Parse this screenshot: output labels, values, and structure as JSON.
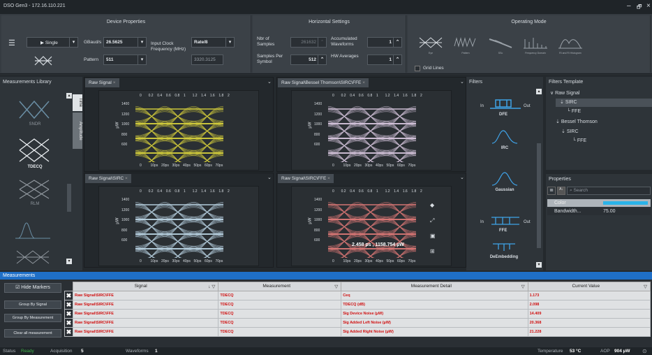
{
  "title": "DSO Gen3 - 172.16.110.221",
  "window_controls": [
    "–",
    "🗗",
    "×"
  ],
  "device_properties": {
    "title": "Device Properties",
    "mode": "Single",
    "gbaud_label": "GBaud/s",
    "gbaud_value": "26.5625",
    "input_clock_label": "Input Clock Frequency (MHz)",
    "rate_value": "Rate/8",
    "freq_value": "3320.3125",
    "pattern_label": "Pattern",
    "pattern_value": "511"
  },
  "horizontal": {
    "title": "Horizontal Settings",
    "nbr_samples_label": "Nbr of Samples",
    "nbr_samples_value": "261632",
    "accum_label": "Accumulated Waveforms",
    "accum_value": "1",
    "sps_label": "Samples Per Symbol",
    "sps_value": "512",
    "hw_avg_label": "HW Averages",
    "hw_avg_value": "1"
  },
  "operating": {
    "title": "Operating Mode",
    "modes": [
      "Eye",
      "Pattern",
      "SSc",
      "Frequency Domain",
      "RI and RI Histogram"
    ],
    "grid_lines": "Grid Lines"
  },
  "meas_library": {
    "title": "Measurements Library",
    "items": [
      "SNDR",
      "TDECQ",
      "RLM",
      "",
      "Time",
      "Amplitude"
    ]
  },
  "plots": [
    {
      "tab": "Raw Signal",
      "color": "#d8d23c"
    },
    {
      "tab": "Raw Signal\\Bessel Thomson\\SIRC\\FFE",
      "color": "#d9c8e0"
    },
    {
      "tab": "Raw Signal\\SIRC",
      "color": "#bcd6e6"
    },
    {
      "tab": "Raw Signal\\SIRC\\FFE",
      "color": "#e07a78"
    }
  ],
  "plot_axes": {
    "top_ticks": [
      "0",
      "0.2",
      "0.4",
      "0.6",
      "0.8",
      "1",
      "1.2",
      "1.4",
      "1.6",
      "1.8",
      "2"
    ],
    "bottom_ticks": [
      "0",
      "10ps",
      "20ps",
      "30ps",
      "40ps",
      "50ps",
      "60ps",
      "70ps"
    ],
    "y_ticks": [
      "1400",
      "1200",
      "1000",
      "800",
      "600"
    ],
    "y_label": "µW"
  },
  "cursor_readout": "2.458 ps , 1158.754 µW",
  "filters": {
    "title": "Filters",
    "items": [
      "DFE",
      "IRC",
      "Gaussian",
      "FFE",
      "DeEmbedding"
    ],
    "in": "In",
    "out": "Out"
  },
  "filters_template": {
    "title": "Filters Template",
    "tree": [
      "Raw Signal",
      "SIRC",
      "FFE",
      "Bessel Thomson",
      "SIRC",
      "FFE"
    ]
  },
  "properties": {
    "title": "Properties",
    "search_placeholder": "Search",
    "rows": [
      {
        "name": "Color",
        "value": ""
      },
      {
        "name": "Bandwidth...",
        "value": "75.00"
      }
    ]
  },
  "measurements": {
    "bar_title": "Measurements",
    "hide_markers": "Hide Markers",
    "buttons": [
      "Group By Signal",
      "Group By Measurement",
      "Clear all measurement"
    ],
    "headers": [
      "Signal",
      "Measurement",
      "Measurement Detail",
      "Current Value"
    ],
    "rows": [
      {
        "signal": "Raw Signal\\SIRC\\FFE",
        "measurement": "TDECQ",
        "detail": "Ceq",
        "value": "1.173"
      },
      {
        "signal": "Raw Signal\\SIRC\\FFE",
        "measurement": "TDECQ",
        "detail": "TDECQ (dB)",
        "value": "2.098"
      },
      {
        "signal": "Raw Signal\\SIRC\\FFE",
        "measurement": "TDECQ",
        "detail": "Sig Device Noise (µW)",
        "value": "14.409"
      },
      {
        "signal": "Raw Signal\\SIRC\\FFE",
        "measurement": "TDECQ",
        "detail": "Sig Added Left Noise (µW)",
        "value": "20.368"
      },
      {
        "signal": "Raw Signal\\SIRC\\FFE",
        "measurement": "TDECQ",
        "detail": "Sig Added Right Noise (µW)",
        "value": "21.228"
      }
    ]
  },
  "status": {
    "status_label": "Status",
    "status_value": "Ready",
    "acq_label": "Acquisition",
    "acq_value": "5",
    "wf_label": "Waveforms",
    "wf_value": "1",
    "temp_label": "Temperature",
    "temp_value": "53 °C",
    "aop_label": "AOP",
    "aop_value": "904 µW"
  }
}
